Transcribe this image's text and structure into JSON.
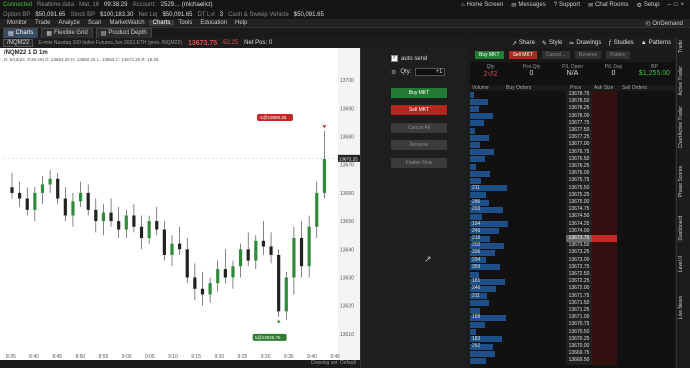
{
  "topbar": {
    "connected": "Connected",
    "realtime": "Realtime data",
    "date": "Mat, 16",
    "time": "09:38:29",
    "account_label": "Account:",
    "account_value": "2529… (michaelict)",
    "links": [
      "Home Screen",
      "Messages",
      "Support",
      "Chat Rooms",
      "Setup"
    ]
  },
  "acctbar": [
    {
      "l": "Option BP",
      "v": "$50,091.65"
    },
    {
      "l": "Stock BP",
      "v": "$100,183.30"
    },
    {
      "l": "Net Liq",
      "v": "$50,091.65"
    },
    {
      "l": "DT Lvl",
      "v": "3"
    },
    {
      "l": "Cash & Sweep Vehicle",
      "v": "$50,091.65"
    }
  ],
  "menu": [
    "Monitor",
    "Trade",
    "Analyze",
    "Scan",
    "MarketWatch",
    "Charts",
    "Tools",
    "Education",
    "Help"
  ],
  "menu_active": "Charts",
  "ondemand": "OnDemand",
  "tabs": [
    "Charts",
    "Flexible Grid",
    "Product Depth"
  ],
  "chart": {
    "symbol": "/NQM22",
    "desc": "E-mini Nasdaq 100 Index Futures,Jun-2022,ETH (prev. /NQM22)",
    "last": "13673.75",
    "change": "-52.25",
    "netpos": "Net Pos: 0",
    "title": "/NQM22 1 D 1m",
    "ohlc": "D: 5/16/22, 9:38 AM   O: 13663.25   H: 13682.25   L: 13663   C: 13672.25   R: 19.25",
    "annot_top": "-1@13680.25",
    "annot_bottom": "1@13625.75",
    "price_tag": "13672.25",
    "drawing_set": "Drawing set: Default",
    "y_ticks": [
      "13700",
      "13690",
      "13680",
      "13670",
      "13660",
      "13650",
      "13640",
      "13630",
      "13620",
      "13610"
    ],
    "x_ticks": [
      "8:35",
      "8:40",
      "8:45",
      "8:50",
      "8:55",
      "9:00",
      "9:05",
      "9:10",
      "9:15",
      "9:20",
      "9:25",
      "9:30",
      "9:35",
      "9:40",
      "9:45"
    ]
  },
  "chart_data": {
    "type": "candlestick",
    "title": "/NQM22 1 D 1m",
    "x_ticks": [
      "8:35",
      "8:40",
      "8:45",
      "8:50",
      "8:55",
      "9:00",
      "9:05",
      "9:10",
      "9:15",
      "9:20",
      "9:25",
      "9:30",
      "9:35",
      "9:40",
      "9:45"
    ],
    "ylim": [
      13605,
      13705
    ],
    "candles": [
      [
        13662,
        13667,
        13658,
        13660
      ],
      [
        13660,
        13664,
        13655,
        13658
      ],
      [
        13658,
        13662,
        13652,
        13654
      ],
      [
        13654,
        13662,
        13650,
        13660
      ],
      [
        13660,
        13666,
        13656,
        13663
      ],
      [
        13663,
        13668,
        13660,
        13665
      ],
      [
        13665,
        13667,
        13656,
        13658
      ],
      [
        13658,
        13662,
        13650,
        13652
      ],
      [
        13652,
        13660,
        13648,
        13657
      ],
      [
        13657,
        13664,
        13655,
        13660
      ],
      [
        13660,
        13663,
        13652,
        13654
      ],
      [
        13654,
        13658,
        13646,
        13650
      ],
      [
        13650,
        13656,
        13645,
        13653
      ],
      [
        13653,
        13658,
        13648,
        13650
      ],
      [
        13650,
        13655,
        13644,
        13647
      ],
      [
        13647,
        13654,
        13644,
        13652
      ],
      [
        13652,
        13656,
        13646,
        13648
      ],
      [
        13648,
        13652,
        13640,
        13644
      ],
      [
        13644,
        13652,
        13642,
        13650
      ],
      [
        13650,
        13655,
        13645,
        13647
      ],
      [
        13647,
        13650,
        13636,
        13638
      ],
      [
        13638,
        13645,
        13634,
        13642
      ],
      [
        13642,
        13648,
        13638,
        13640
      ],
      [
        13640,
        13644,
        13628,
        13630
      ],
      [
        13630,
        13635,
        13622,
        13626
      ],
      [
        13626,
        13632,
        13620,
        13624
      ],
      [
        13624,
        13630,
        13621,
        13628
      ],
      [
        13628,
        13636,
        13625,
        13633
      ],
      [
        13633,
        13640,
        13628,
        13630
      ],
      [
        13630,
        13636,
        13626,
        13634
      ],
      [
        13634,
        13642,
        13630,
        13640
      ],
      [
        13640,
        13646,
        13634,
        13636
      ],
      [
        13636,
        13645,
        13633,
        13643
      ],
      [
        13643,
        13650,
        13638,
        13641
      ],
      [
        13641,
        13646,
        13635,
        13638
      ],
      [
        13638,
        13640,
        13616,
        13618
      ],
      [
        13618,
        13632,
        13615,
        13630
      ],
      [
        13630,
        13648,
        13624,
        13644
      ],
      [
        13644,
        13650,
        13630,
        13634
      ],
      [
        13634,
        13652,
        13630,
        13648
      ],
      [
        13648,
        13664,
        13644,
        13660
      ],
      [
        13660,
        13682,
        13658,
        13672
      ]
    ]
  },
  "order": {
    "auto_send": "auto send",
    "qty_label": "Qty:",
    "qty": "+1",
    "buy_mkt": "Buy MKT",
    "sell_mkt": "Sell MKT",
    "cancel_all": "Cancel All",
    "reverse": "Reverse",
    "flatten_now": "Flatten Now"
  },
  "right": {
    "tools": [
      "Share",
      "Style",
      "Drawings",
      "Studies",
      "Patterns"
    ],
    "buttons": [
      "Buy MKT",
      "Sell MKT",
      "Cancel...",
      "Reverse",
      "Flatten"
    ],
    "stats": [
      {
        "l": "Qty",
        "v": "2↺2"
      },
      {
        "l": "Pos Qty",
        "v": "0"
      },
      {
        "l": "P/L Open",
        "v": "N/A"
      },
      {
        "l": "P/L Day",
        "v": "0"
      },
      {
        "l": "BP",
        "v": "$1,255.00"
      }
    ],
    "headers": [
      "Volume",
      "Buy Orders",
      "Price",
      "Ask Size",
      "Sell Orders"
    ],
    "ladder": [
      {
        "p": "13678.75",
        "v": ""
      },
      {
        "p": "13678.50",
        "v": ""
      },
      {
        "p": "13678.25",
        "v": ""
      },
      {
        "p": "13678.00",
        "v": ""
      },
      {
        "p": "13677.75",
        "v": ""
      },
      {
        "p": "13677.50",
        "v": ""
      },
      {
        "p": "13677.25",
        "v": ""
      },
      {
        "p": "13677.00",
        "v": ""
      },
      {
        "p": "13676.75",
        "v": ""
      },
      {
        "p": "13676.50",
        "v": ""
      },
      {
        "p": "13676.25",
        "v": ""
      },
      {
        "p": "13676.00",
        "v": ""
      },
      {
        "p": "13675.75",
        "v": ""
      },
      {
        "p": "13675.50",
        "v": "211"
      },
      {
        "p": "13675.25",
        "v": ""
      },
      {
        "p": "13675.00",
        "v": "286"
      },
      {
        "p": "13674.75",
        "v": "203"
      },
      {
        "p": "13674.50",
        "v": ""
      },
      {
        "p": "13674.25",
        "v": "194"
      },
      {
        "p": "13674.00",
        "v": "249"
      },
      {
        "p": "13673.75",
        "v": "218"
      },
      {
        "p": "13673.50",
        "v": "203"
      },
      {
        "p": "13673.25",
        "v": "206"
      },
      {
        "p": "13673.00",
        "v": "294"
      },
      {
        "p": "13672.75",
        "v": "359"
      },
      {
        "p": "13672.50",
        "v": ""
      },
      {
        "p": "13672.25",
        "v": "181"
      },
      {
        "p": "13672.00",
        "v": "246"
      },
      {
        "p": "13671.75",
        "v": "211"
      },
      {
        "p": "13671.50",
        "v": ""
      },
      {
        "p": "13671.25",
        "v": ""
      },
      {
        "p": "13671.00",
        "v": "188"
      },
      {
        "p": "13670.75",
        "v": ""
      },
      {
        "p": "13670.50",
        "v": ""
      },
      {
        "p": "13670.25",
        "v": "183"
      },
      {
        "p": "13670.00",
        "v": "252"
      },
      {
        "p": "13669.75",
        "v": ""
      },
      {
        "p": "13669.50",
        "v": ""
      }
    ],
    "current_price": "13673.75",
    "side_tabs": [
      "Trade",
      "Active Trader",
      "Active Trader",
      "Chart",
      "Phase Scores",
      "Dashboard",
      "Level II",
      "Live News"
    ]
  }
}
